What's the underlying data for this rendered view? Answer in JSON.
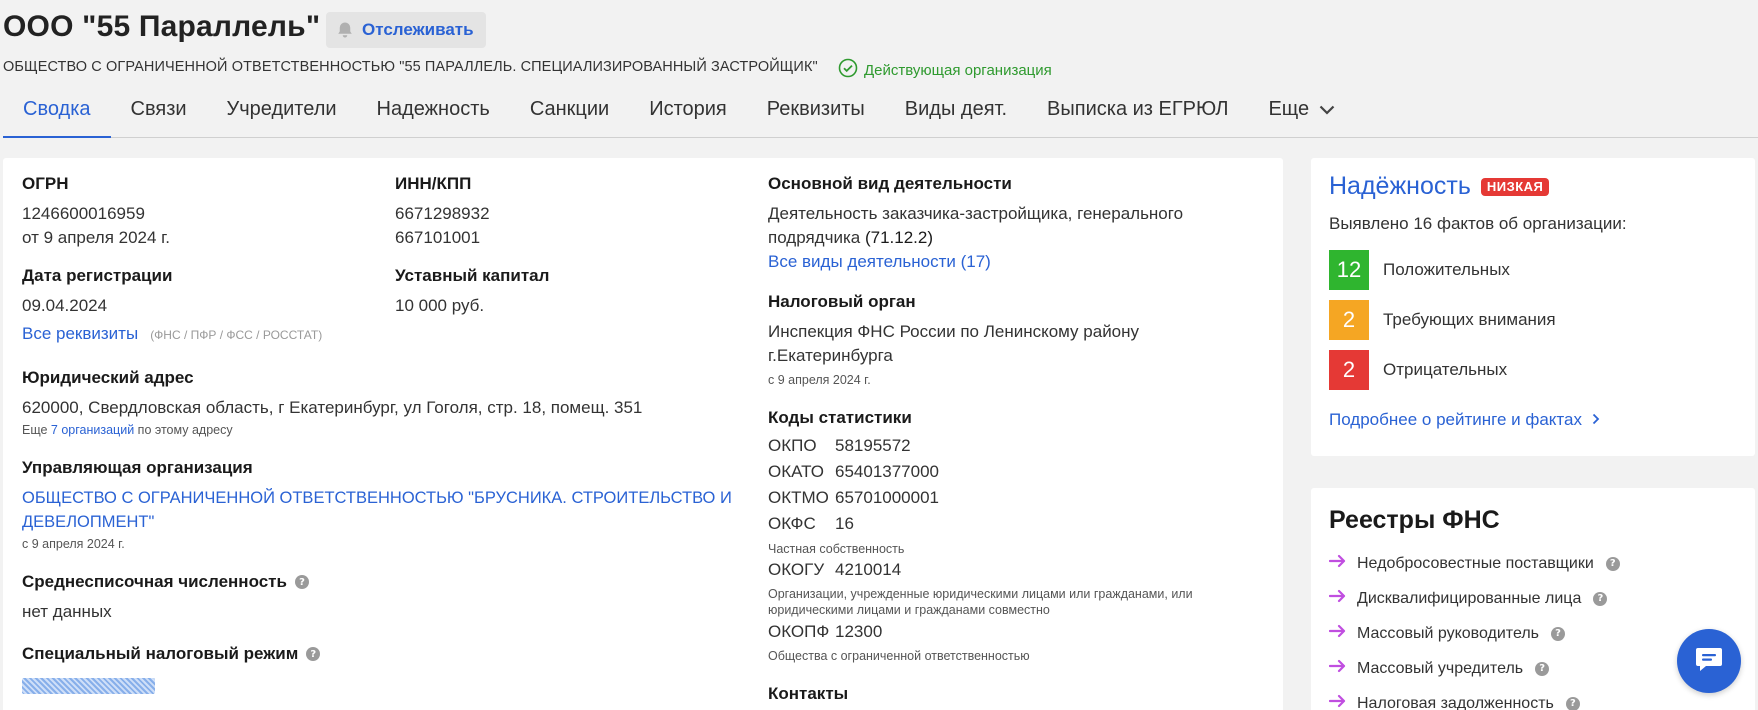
{
  "header": {
    "title": "ООО \"55 Параллель\"",
    "follow_label": "Отслеживать",
    "full_name": "ОБЩЕСТВО С ОГРАНИЧЕННОЙ ОТВЕТСТВЕННОСТЬЮ \"55 ПАРАЛЛЕЛЬ. СПЕЦИАЛИЗИРОВАННЫЙ ЗАСТРОЙЩИК\"",
    "status": "Действующая организация"
  },
  "tabs": [
    {
      "label": "Сводка"
    },
    {
      "label": "Связи"
    },
    {
      "label": "Учредители"
    },
    {
      "label": "Надежность"
    },
    {
      "label": "Санкции"
    },
    {
      "label": "История"
    },
    {
      "label": "Реквизиты"
    },
    {
      "label": "Виды деят."
    },
    {
      "label": "Выписка из ЕГРЮЛ"
    },
    {
      "label": "Еще"
    }
  ],
  "summary": {
    "ogrn_label": "ОГРН",
    "ogrn_value": "1246600016959",
    "ogrn_date": "от 9 апреля 2024 г.",
    "inn_label": "ИНН/КПП",
    "inn_value": "6671298932",
    "kpp_value": "667101001",
    "reg_date_label": "Дата регистрации",
    "reg_date_value": "09.04.2024",
    "capital_label": "Уставный капитал",
    "capital_value": "10 000 руб.",
    "all_requisites": "Все реквизиты",
    "requisites_sources": "(ФНС / ПФР / ФСС / РОССТАТ)",
    "address_label": "Юридический адрес",
    "address_value": "620000, Свердловская область, г Екатеринбург, ул Гоголя, стр. 18, помещ. 351",
    "address_more_prefix": "Еще",
    "address_more_link": "7 организаций",
    "address_more_suffix": "по этому адресу",
    "mgmt_label": "Управляющая организация",
    "mgmt_value": "ОБЩЕСТВО С ОГРАНИЧЕННОЙ ОТВЕТСТВЕННОСТЬЮ \"БРУСНИКА. СТРОИТЕЛЬСТВО И ДЕВЕЛОПМЕНТ\"",
    "mgmt_since": "с 9 апреля 2024 г.",
    "headcount_label": "Среднесписочная численность",
    "headcount_value": "нет данных",
    "tax_regime_label": "Специальный налоговый режим",
    "activity_label": "Основной вид деятельности",
    "activity_value": "Деятельность заказчика-застройщика, генерального подрядчика",
    "activity_code": "(71.12.2)",
    "activity_all": "Все виды деятельности (17)",
    "tax_authority_label": "Налоговый орган",
    "tax_authority_value": "Инспекция ФНС России по Ленинскому району г.Екатеринбурга",
    "tax_authority_since": "с 9 апреля 2024 г.",
    "stats_label": "Коды статистики",
    "okpo_key": "ОКПО",
    "okpo_val": "58195572",
    "okato_key": "ОКАТО",
    "okato_val": "65401377000",
    "oktmo_key": "ОКТМО",
    "oktmo_val": "65701000001",
    "okfs_key": "ОКФС",
    "okfs_val": "16",
    "okfs_desc": "Частная собственность",
    "okogu_key": "ОКОГУ",
    "okogu_val": "4210014",
    "okogu_desc": "Организации, учрежденные юридическими лицами или гражданами, или юридическими лицами и гражданами совместно",
    "okopf_key": "ОКОПФ",
    "okopf_val": "12300",
    "okopf_desc": "Общества с ограниченной ответственностью",
    "contacts_label": "Контакты"
  },
  "reliability": {
    "title": "Надёжность",
    "badge": "НИЗКАЯ",
    "subtitle": "Выявлено 16 фактов об организации:",
    "facts": [
      {
        "count": "12",
        "label": "Положительных",
        "color": "#2fb52f"
      },
      {
        "count": "2",
        "label": "Требующих внимания",
        "color": "#f5a623"
      },
      {
        "count": "2",
        "label": "Отрицательных",
        "color": "#e53935"
      }
    ],
    "more_link": "Подробнее о рейтинге и фактах"
  },
  "registries": {
    "title": "Реестры ФНС",
    "items": [
      {
        "label": "Недобросовестные поставщики"
      },
      {
        "label": "Дисквалифицированные лица"
      },
      {
        "label": "Массовый руководитель"
      },
      {
        "label": "Массовый учредитель"
      },
      {
        "label": "Налоговая задолженность"
      }
    ],
    "arrow_color": "#c04ee0"
  },
  "colors": {
    "accent": "#2a62d4",
    "active_status": "#2f9a2f"
  }
}
